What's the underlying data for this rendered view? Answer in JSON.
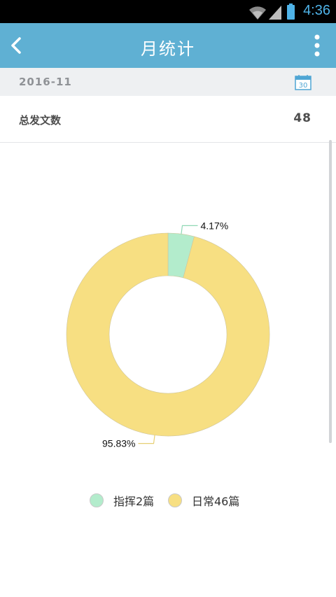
{
  "status_bar": {
    "time": "4:36",
    "icons": [
      "wifi-icon",
      "signal-icon",
      "battery-icon"
    ]
  },
  "app_bar": {
    "title": "月统计",
    "back_icon": "chevron-left-icon",
    "menu_icon": "more-vert-icon"
  },
  "month": {
    "value": "2016-11",
    "calendar_icon_day": "30"
  },
  "summary": {
    "label": "总发文数",
    "value": "48"
  },
  "chart_data": {
    "type": "pie",
    "slices": [
      {
        "name": "指挥2篇",
        "value": 2,
        "percent_label": "4.17%",
        "color": "#b3eccc"
      },
      {
        "name": "日常46篇",
        "value": 46,
        "percent_label": "95.83%",
        "color": "#f7df82"
      }
    ],
    "legend_position": "bottom"
  },
  "colors": {
    "app_bar": "#5fb0d3",
    "month_bg": "#eef0f2"
  }
}
